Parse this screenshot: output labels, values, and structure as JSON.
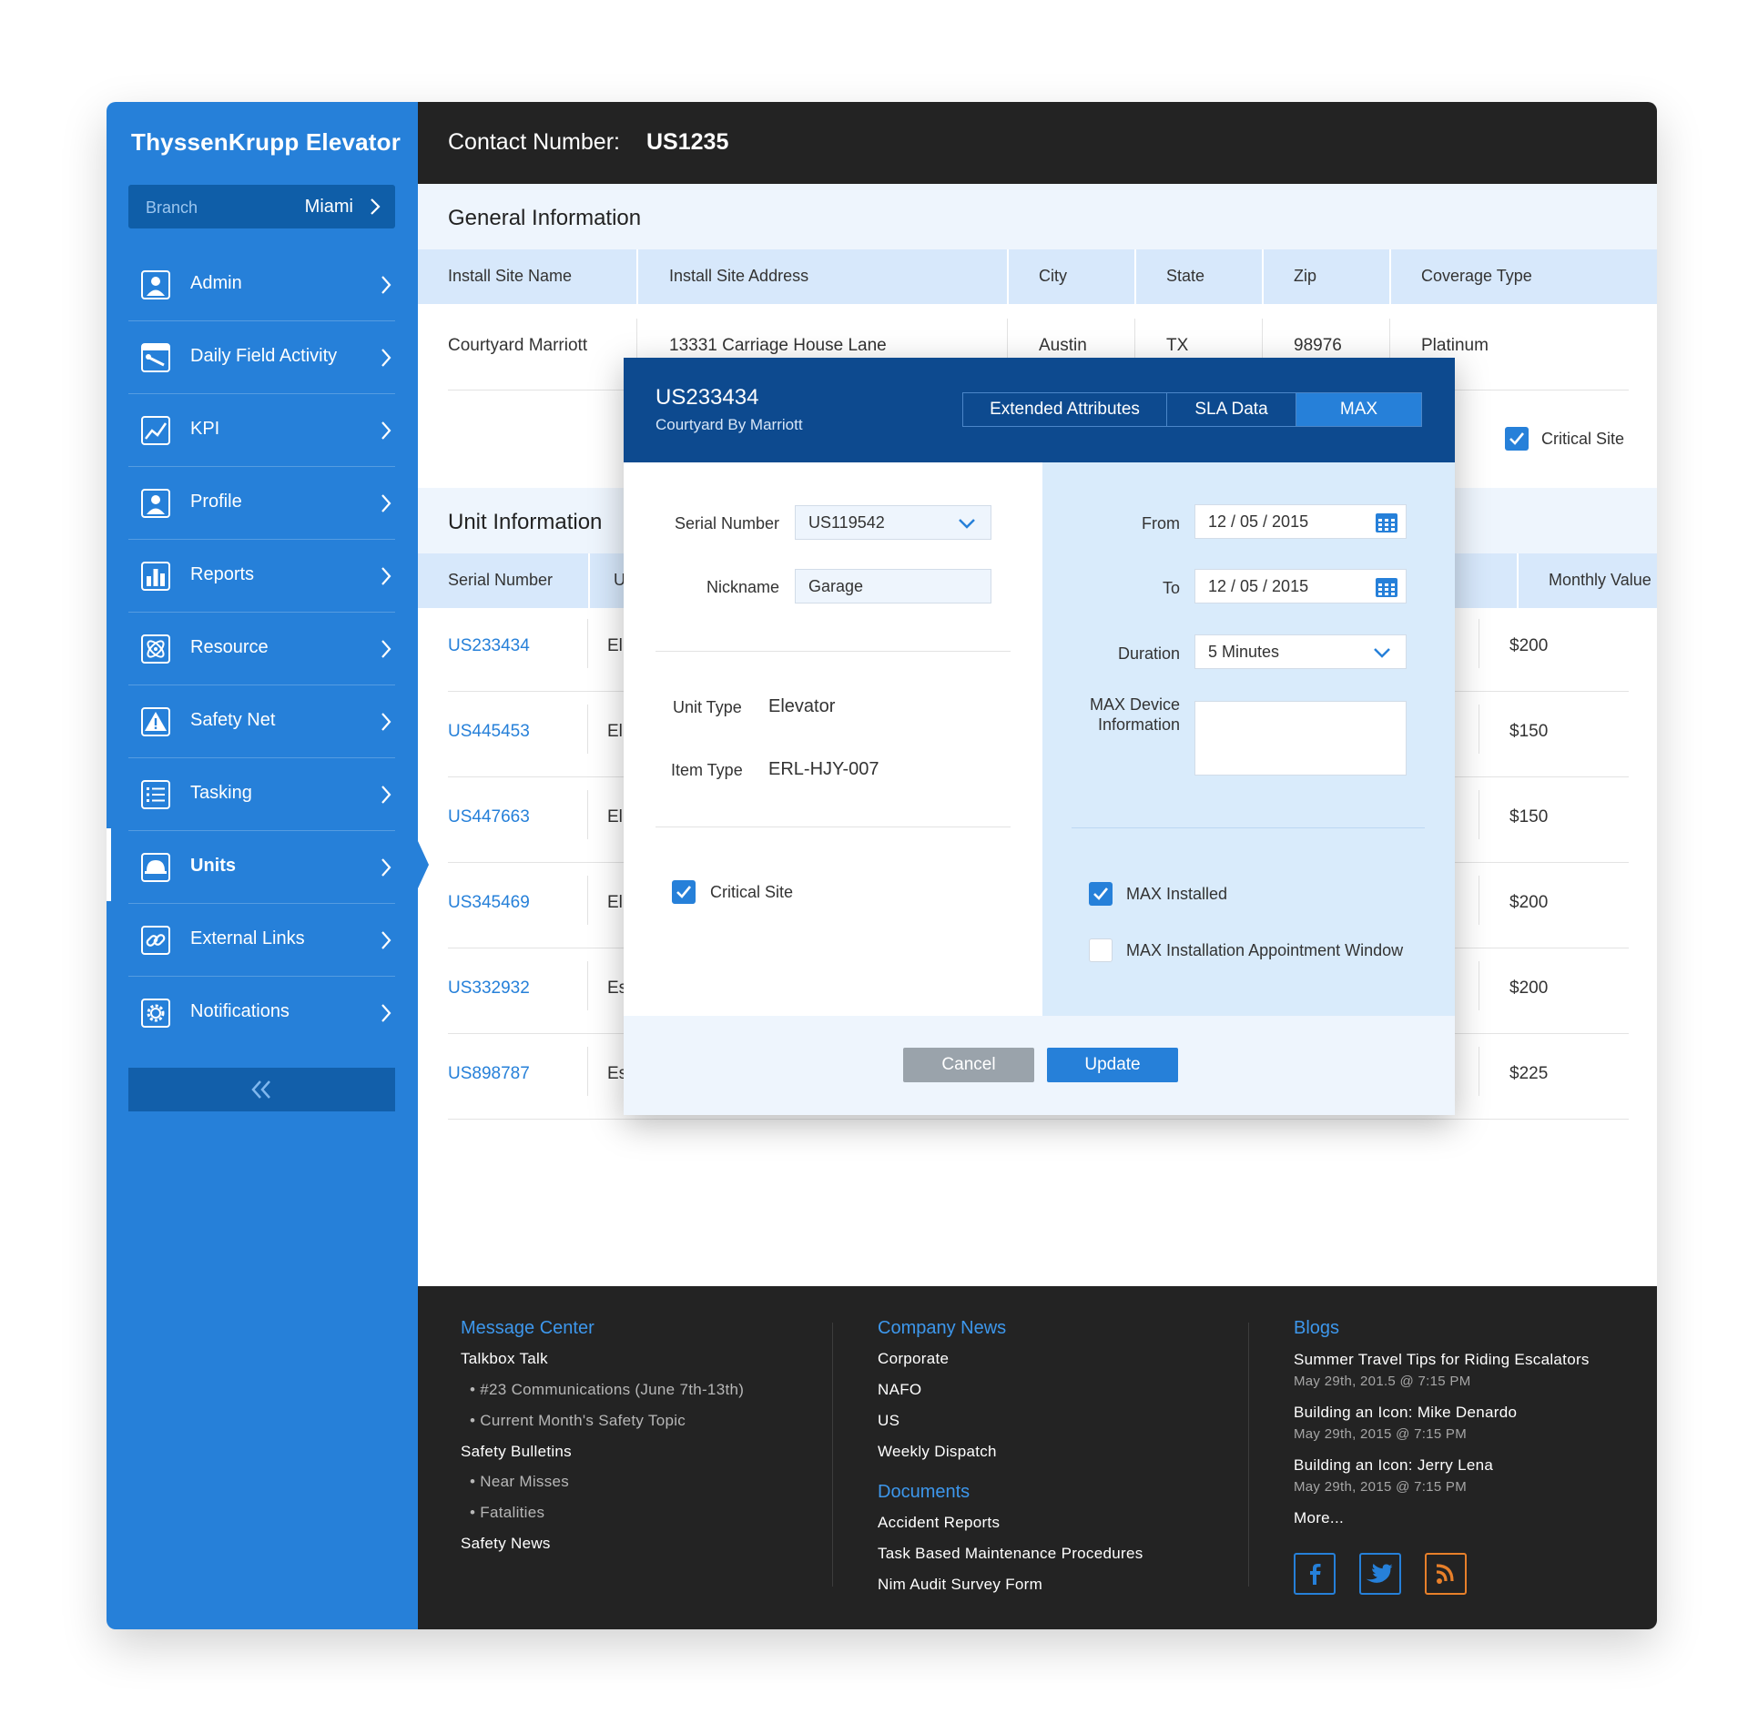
{
  "app": {
    "brand": "ThyssenKrupp Elevator",
    "branch_label": "Branch",
    "branch_value": "Miami"
  },
  "sidebar": {
    "items": [
      {
        "label": "Admin",
        "icon": "user-icon"
      },
      {
        "label": "Daily Field Activity",
        "icon": "tools-icon"
      },
      {
        "label": "KPI",
        "icon": "line-chart-icon"
      },
      {
        "label": "Profile",
        "icon": "user-icon"
      },
      {
        "label": "Reports",
        "icon": "bar-chart-icon"
      },
      {
        "label": "Resource",
        "icon": "atom-icon"
      },
      {
        "label": "Safety Net",
        "icon": "warning-icon"
      },
      {
        "label": "Tasking",
        "icon": "list-icon"
      },
      {
        "label": "Units",
        "icon": "hard-hat-icon",
        "active": true
      },
      {
        "label": "External Links",
        "icon": "link-icon"
      },
      {
        "label": "Notifications",
        "icon": "gear-icon"
      }
    ],
    "collapse_icon": "double-chevron-left-icon"
  },
  "header": {
    "label": "Contact Number:",
    "value": "US1235"
  },
  "general": {
    "title": "General Information",
    "columns": [
      "Install Site Name",
      "Install Site Address",
      "City",
      "State",
      "Zip",
      "Coverage Type"
    ],
    "row": [
      "Courtyard Marriott",
      "13331 Carriage House Lane",
      "Austin",
      "TX",
      "98976",
      "Platinum"
    ],
    "critical_site_label": "Critical Site",
    "critical_site_checked": true
  },
  "units": {
    "title": "Unit Information",
    "columns": {
      "serial": "Serial Number",
      "type_partial": "U",
      "monthly": "Monthly Value"
    },
    "rows": [
      {
        "serial": "US233434",
        "type_partial": "El",
        "monthly": "$200"
      },
      {
        "serial": "US445453",
        "type_partial": "El",
        "monthly": "$150"
      },
      {
        "serial": "US447663",
        "type_partial": "El",
        "monthly": "$150"
      },
      {
        "serial": "US345469",
        "type_partial": "El",
        "monthly": "$200"
      },
      {
        "serial": "US332932",
        "type_partial": "Es",
        "monthly": "$200"
      },
      {
        "serial": "US898787",
        "type_partial": "Es",
        "monthly": "$225"
      }
    ]
  },
  "modal": {
    "title": "US233434",
    "subtitle": "Courtyard By Marriott",
    "tabs": [
      {
        "label": "Extended Attributes",
        "active": false
      },
      {
        "label": "SLA Data",
        "active": false
      },
      {
        "label": "MAX",
        "active": true
      }
    ],
    "serial_label": "Serial Number",
    "serial_value": "US119542",
    "nickname_label": "Nickname",
    "nickname_value": "Garage",
    "unit_type_label": "Unit Type",
    "unit_type_value": "Elevator",
    "item_type_label": "Item Type",
    "item_type_value": "ERL-HJY-007",
    "critical_label": "Critical Site",
    "critical_checked": true,
    "from_label": "From",
    "from_value": "12 / 05 / 2015",
    "to_label": "To",
    "to_value": "12 / 05 / 2015",
    "duration_label": "Duration",
    "duration_value": "5 Minutes",
    "max_device_label_1": "MAX Device",
    "max_device_label_2": "Information",
    "max_device_value": "",
    "max_installed_label": "MAX Installed",
    "max_installed_checked": true,
    "max_window_label": "MAX Installation Appointment Window",
    "max_window_checked": false,
    "cancel_label": "Cancel",
    "update_label": "Update"
  },
  "footer": {
    "message_center": {
      "title": "Message Center",
      "talkbox": "Talkbox Talk",
      "talkbox_items": [
        "#23 Communications (June 7th-13th)",
        "Current Month's Safety Topic"
      ],
      "bulletins": "Safety Bulletins",
      "bulletin_items": [
        "Near Misses",
        "Fatalities"
      ],
      "news": "Safety News"
    },
    "company_news": {
      "title": "Company News",
      "items": [
        "Corporate",
        "NAFO",
        "US",
        "Weekly Dispatch"
      ]
    },
    "documents": {
      "title": "Documents",
      "items": [
        "Accident Reports",
        "Task Based Maintenance Procedures",
        "Nim Audit Survey Form"
      ]
    },
    "blogs": {
      "title": "Blogs",
      "items": [
        {
          "title": "Summer Travel Tips for Riding Escalators",
          "date": "May 29th, 201.5 @ 7:15 PM"
        },
        {
          "title": "Building an Icon: Mike Denardo",
          "date": "May 29th, 2015 @ 7:15 PM"
        },
        {
          "title": "Building an Icon: Jerry Lena",
          "date": "May 29th, 2015 @ 7:15 PM"
        }
      ],
      "more": "More..."
    },
    "social": [
      {
        "icon": "facebook-icon",
        "color": "#2680d9"
      },
      {
        "icon": "twitter-icon",
        "color": "#2680d9"
      },
      {
        "icon": "rss-icon",
        "color": "#e8802a"
      }
    ]
  }
}
